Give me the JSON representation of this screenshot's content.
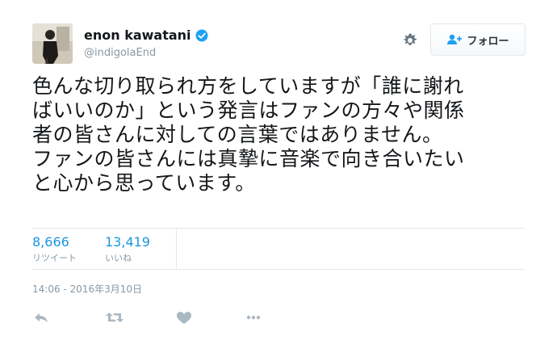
{
  "user": {
    "display_name": "enon kawatani",
    "handle": "@indigolaEnd",
    "verified_icon": "verified-badge-icon"
  },
  "follow_button": {
    "label": "フォロー",
    "icon": "add-user-icon"
  },
  "settings_icon": "gear-icon",
  "tweet": {
    "lines": [
      "色んな切り取られ方をしていますが「誰に謝れ",
      "ばいいのか」という発言はファンの方々や関係",
      "者の皆さんに対しての言葉ではありません。",
      "ファンの皆さんには真摯に音楽で向き合いたい",
      "と心から思っています。"
    ]
  },
  "stats": {
    "retweets": {
      "count": "8,666",
      "label": "リツイート"
    },
    "likes": {
      "count": "13,419",
      "label": "いいね"
    }
  },
  "timestamp": "14:06 - 2016年3月10日",
  "actions": [
    "reply-icon",
    "retweet-icon",
    "like-icon",
    "more-icon"
  ],
  "colors": {
    "link_blue": "#1b95e0",
    "muted_gray": "#8899a6",
    "divider": "#e1e8ed",
    "action_gray": "#aab8c2"
  }
}
